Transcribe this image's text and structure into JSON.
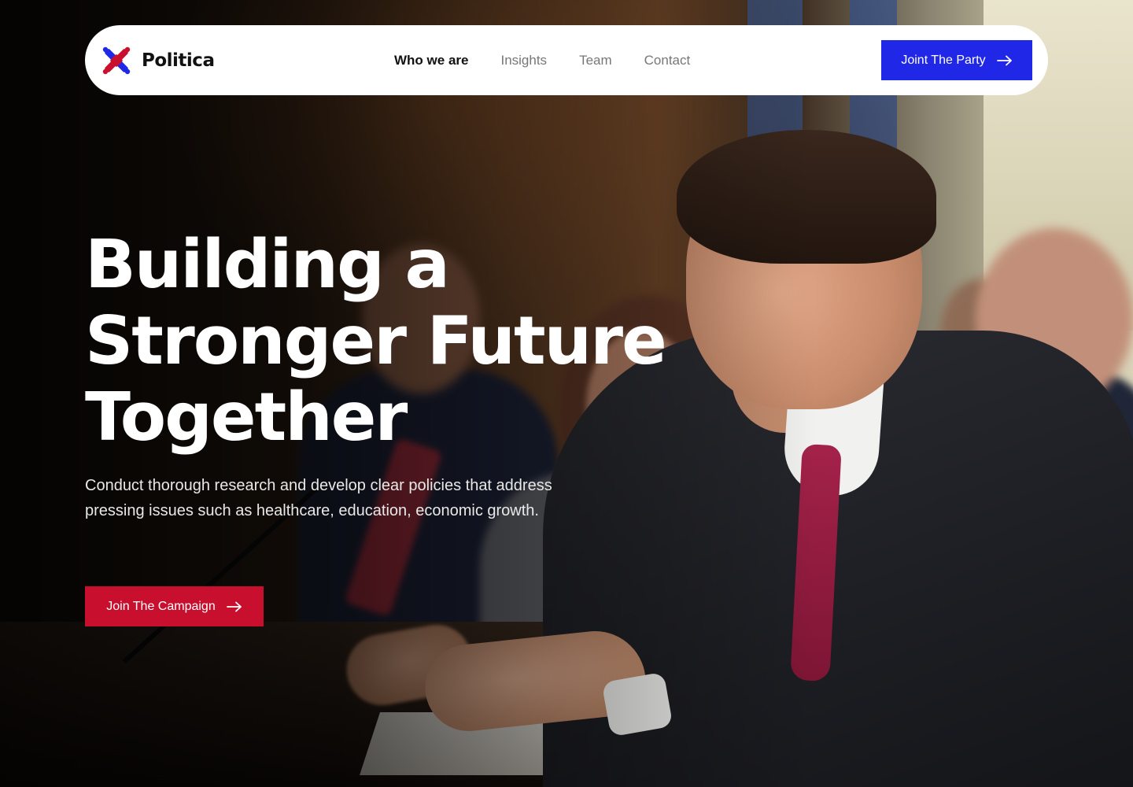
{
  "brand": {
    "name": "Politica",
    "logo_icon": "cross-knot-logo-icon",
    "logo_colors": [
      "#c8102e",
      "#2127e6"
    ]
  },
  "nav": {
    "links": [
      {
        "label": "Who we are",
        "active": true
      },
      {
        "label": "Insights",
        "active": false
      },
      {
        "label": "Team",
        "active": false
      },
      {
        "label": "Contact",
        "active": false
      }
    ],
    "cta_label": "Joint The Party",
    "cta_icon": "arrow-right-icon"
  },
  "hero": {
    "title_lines": [
      "Building a",
      "Stronger Future",
      "Together"
    ],
    "subtitle": "Conduct thorough research and develop clear policies that address pressing issues such as healthcare, education, economic growth.",
    "cta_label": "Join The Campaign",
    "cta_icon": "arrow-right-icon",
    "background_image": "speaker-at-hearing-photo"
  },
  "colors": {
    "primary_blue": "#2127e6",
    "primary_red": "#c8102e",
    "nav_bg": "#ffffff",
    "text_light": "#ffffff"
  }
}
